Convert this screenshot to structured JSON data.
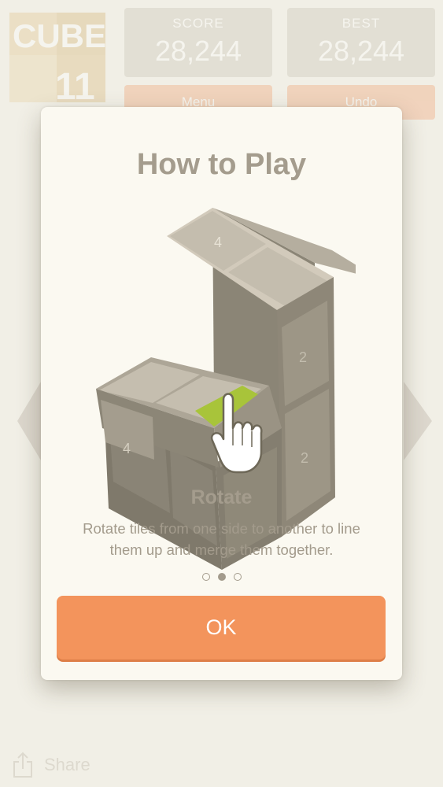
{
  "app": {
    "logo": {
      "line1": "CUBE",
      "line2": "11"
    }
  },
  "stats": {
    "score": {
      "label": "SCORE",
      "value": "28,244"
    },
    "best": {
      "label": "BEST",
      "value": "28,244"
    }
  },
  "toolbar": {
    "menu_label": "Menu",
    "undo_label": "Undo"
  },
  "footer": {
    "share_label": "Share"
  },
  "modal": {
    "title": "How to Play",
    "slide": {
      "title": "Rotate",
      "description": "Rotate tiles from one side to another to line them up and merge them together.",
      "tile_values": [
        "4",
        "4",
        "2",
        "2"
      ]
    },
    "pagination": {
      "total": 3,
      "active_index": 1
    },
    "ok_label": "OK"
  },
  "colors": {
    "accent": "#f3945c",
    "highlight": "#a8c43a",
    "text_muted": "#a49c8d",
    "modal_bg": "#fbf9f1"
  }
}
